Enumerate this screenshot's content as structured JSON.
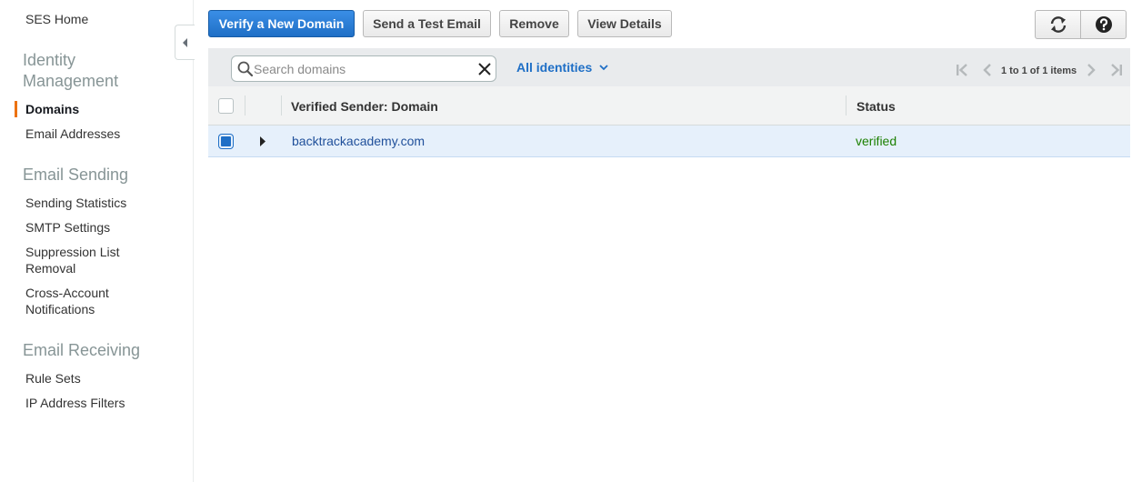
{
  "sidebar": {
    "home_label": "SES Home",
    "sections": [
      {
        "title": "Identity Management",
        "items": [
          "Domains",
          "Email Addresses"
        ]
      },
      {
        "title": "Email Sending",
        "items": [
          "Sending Statistics",
          "SMTP Settings",
          "Suppression List Removal",
          "Cross-Account Notifications"
        ]
      },
      {
        "title": "Email Receiving",
        "items": [
          "Rule Sets",
          "IP Address Filters"
        ]
      }
    ],
    "active_item": "Domains"
  },
  "toolbar": {
    "verify_label": "Verify a New Domain",
    "send_test_label": "Send a Test Email",
    "remove_label": "Remove",
    "view_details_label": "View Details"
  },
  "filter": {
    "search_placeholder": "Search domains",
    "search_value": "",
    "identity_filter": "All identities",
    "pager_text": "1 to 1 of 1 items"
  },
  "table": {
    "columns": [
      "Verified Sender: Domain",
      "Status"
    ],
    "rows": [
      {
        "domain": "backtrackacademy.com",
        "status": "verified",
        "selected": true
      }
    ]
  },
  "colors": {
    "primary": "#1f6fc6",
    "active_indicator": "#ec7211",
    "status_verified": "#1d8102",
    "selected_row": "#e6f0fb"
  }
}
